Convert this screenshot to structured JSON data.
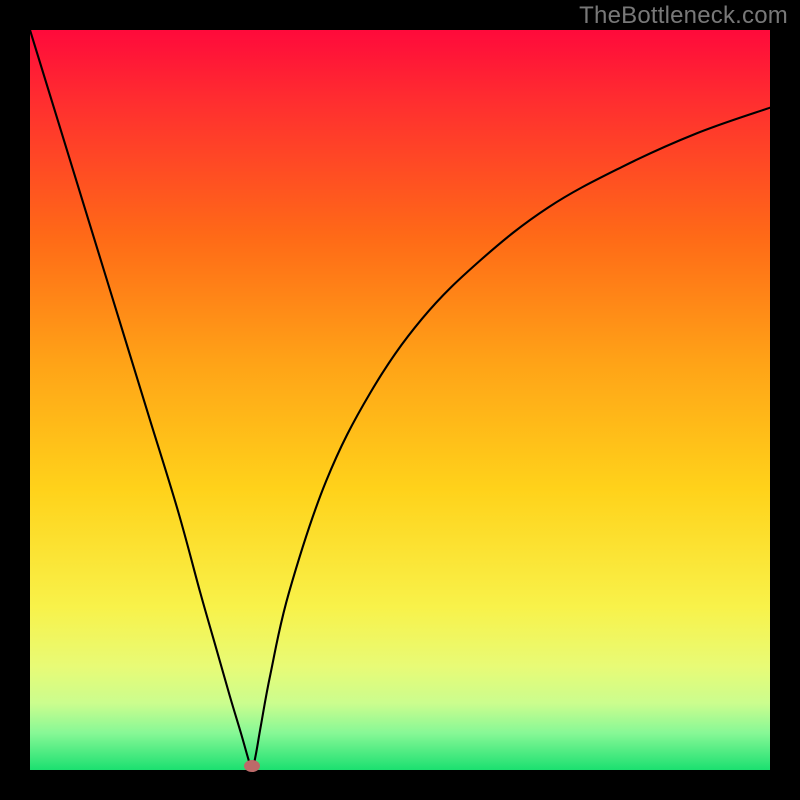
{
  "watermark": "TheBottleneck.com",
  "colors": {
    "curve_stroke": "#000000",
    "marker_fill": "#bc6a69",
    "frame": "#000000"
  },
  "chart_data": {
    "type": "line",
    "title": "",
    "xlabel": "",
    "ylabel": "",
    "xlim": [
      0,
      100
    ],
    "ylim": [
      0,
      100
    ],
    "grid": false,
    "description": "Single V-shaped bottleneck curve over vertical red→yellow→green gradient. Left branch descends steeply from upper-left corner to a sharp minimum near x≈30, y≈0; right branch rises with decreasing slope toward upper-right.",
    "marker": {
      "x": 30,
      "y": 0
    },
    "series": [
      {
        "name": "bottleneck-curve",
        "x": [
          0,
          4,
          8,
          12,
          16,
          20,
          23,
          25,
          27,
          28.5,
          29.5,
          30,
          30.5,
          31.2,
          32.5,
          35,
          40,
          46,
          53,
          61,
          70,
          80,
          90,
          100
        ],
        "values": [
          100,
          87,
          74,
          61,
          48,
          35,
          24,
          17,
          10,
          5,
          1.5,
          0,
          2,
          6,
          13,
          24,
          39,
          51,
          61,
          69,
          76,
          81.5,
          86,
          89.5
        ]
      }
    ]
  }
}
